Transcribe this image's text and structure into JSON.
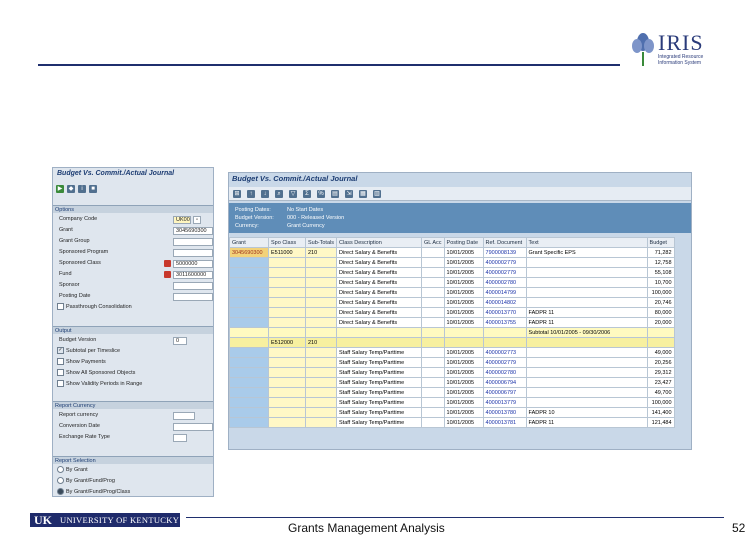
{
  "logo": {
    "name": "IRIS",
    "subtitle": "Integrated Resource Information System"
  },
  "left_panel": {
    "title": "Budget Vs. Commit./Actual Journal",
    "sections": {
      "options": "Options",
      "output": "Output",
      "report_currency": "Report Currency",
      "report_selection": "Report Selection"
    },
    "fields": [
      {
        "label": "Company Code",
        "value": "UK00"
      },
      {
        "label": "Grant",
        "value": "3045690300"
      },
      {
        "label": "Grant Group",
        "value": ""
      },
      {
        "label": "Sponsored Program",
        "value": ""
      },
      {
        "label": "Sponsored Class",
        "value": "5000000"
      },
      {
        "label": "Fund",
        "value": "3011600000"
      },
      {
        "label": "Sponsor",
        "value": ""
      },
      {
        "label": "Posting Date",
        "value": ""
      }
    ],
    "passthrough": "Passthrough Consolidation",
    "output": {
      "budget_version_label": "Budget Version",
      "budget_version_value": "0",
      "checks": [
        "Subtotal per Timeslice",
        "Show Payments",
        "Show All Sponsored Objects",
        "Show Validity Periods in Range"
      ]
    },
    "currency": [
      "Report currency",
      "Conversion Date",
      "Exchange Rate Type"
    ],
    "selection": [
      "By Grant",
      "By Grant/Fund/Prog",
      "By Grant/Fund/Prog/Class"
    ]
  },
  "right_panel": {
    "title": "Budget Vs. Commit./Actual Journal",
    "header": {
      "posting_dates_label": "Posting Dates:",
      "posting_dates_value": "No Start Dates",
      "budget_version_label": "Budget Version:",
      "budget_version_value": "000 - Released Version",
      "currency_label": "Currency:",
      "currency_value": "Grant Currency"
    },
    "columns": [
      "Grant",
      "Spo Class",
      "Sub-Totals",
      "Class Description",
      "GL Acc",
      "Posting Date",
      "Ref. Document",
      "Text",
      "Budget"
    ],
    "rows": [
      {
        "grant": "3045690300",
        "class": "E511000",
        "sub": "210",
        "desc": "Direct Salary & Benefits",
        "date": "10/01/2005",
        "doc": "7900008139",
        "text": "Grant Specific EPS",
        "budget": "71,282"
      },
      {
        "grant": "",
        "class": "",
        "sub": "",
        "desc": "Direct Salary & Benefits",
        "date": "10/01/2005",
        "doc": "4000002779",
        "text": "",
        "budget": "12,758"
      },
      {
        "grant": "",
        "class": "",
        "sub": "",
        "desc": "Direct Salary & Benefits",
        "date": "10/01/2005",
        "doc": "4000002779",
        "text": "",
        "budget": "55,108"
      },
      {
        "grant": "",
        "class": "",
        "sub": "",
        "desc": "Direct Salary & Benefits",
        "date": "10/01/2005",
        "doc": "4000002780",
        "text": "",
        "budget": "10,700"
      },
      {
        "grant": "",
        "class": "",
        "sub": "",
        "desc": "Direct Salary & Benefits",
        "date": "10/01/2005",
        "doc": "4000014799",
        "text": "",
        "budget": "100,000"
      },
      {
        "grant": "",
        "class": "",
        "sub": "",
        "desc": "Direct Salary & Benefits",
        "date": "10/01/2005",
        "doc": "4000014802",
        "text": "",
        "budget": "20,746"
      },
      {
        "grant": "",
        "class": "",
        "sub": "",
        "desc": "Direct Salary & Benefits",
        "date": "10/01/2005",
        "doc": "4000013770",
        "text": "FADPR 11",
        "budget": "80,000"
      },
      {
        "grant": "",
        "class": "",
        "sub": "",
        "desc": "Direct Salary & Benefits",
        "date": "10/01/2005",
        "doc": "4000013755",
        "text": "FADPR 11",
        "budget": "20,000"
      },
      {
        "grant": "",
        "class": "",
        "sub": "",
        "desc": "",
        "date": "",
        "doc": "",
        "text": "Subtotal 10/01/2005 - 09/30/2006",
        "budget": "",
        "subtotal": true
      },
      {
        "grant": "",
        "class": "E512000",
        "sub": "210",
        "desc": "",
        "date": "",
        "doc": "",
        "text": "",
        "budget": "",
        "sel": true
      },
      {
        "grant": "",
        "class": "",
        "sub": "",
        "desc": "Staff Salary Temp/Parttime",
        "date": "10/01/2005",
        "doc": "4000002773",
        "text": "",
        "budget": "49,000"
      },
      {
        "grant": "",
        "class": "",
        "sub": "",
        "desc": "Staff Salary Temp/Parttime",
        "date": "10/01/2005",
        "doc": "4000002779",
        "text": "",
        "budget": "20,256"
      },
      {
        "grant": "",
        "class": "",
        "sub": "",
        "desc": "Staff Salary Temp/Parttime",
        "date": "10/01/2005",
        "doc": "4000002780",
        "text": "",
        "budget": "29,312"
      },
      {
        "grant": "",
        "class": "",
        "sub": "",
        "desc": "Staff Salary Temp/Parttime",
        "date": "10/01/2005",
        "doc": "4000006794",
        "text": "",
        "budget": "23,427"
      },
      {
        "grant": "",
        "class": "",
        "sub": "",
        "desc": "Staff Salary Temp/Parttime",
        "date": "10/01/2005",
        "doc": "4000006797",
        "text": "",
        "budget": "49,700"
      },
      {
        "grant": "",
        "class": "",
        "sub": "",
        "desc": "Staff Salary Temp/Parttime",
        "date": "10/01/2005",
        "doc": "4000013779",
        "text": "",
        "budget": "100,000"
      },
      {
        "grant": "",
        "class": "",
        "sub": "",
        "desc": "Staff Salary Temp/Parttime",
        "date": "10/01/2005",
        "doc": "4000013780",
        "text": "FADPR 10",
        "budget": "141,400"
      },
      {
        "grant": "",
        "class": "",
        "sub": "",
        "desc": "Staff Salary Temp/Parttime",
        "date": "10/01/2005",
        "doc": "4000013781",
        "text": "FADPR 11",
        "budget": "121,484"
      }
    ]
  },
  "footer": {
    "uk_logo_mark": "UK",
    "uk_logo_text": "UNIVERSITY OF KENTUCKY",
    "title": "Grants Management Analysis",
    "page": "52"
  }
}
